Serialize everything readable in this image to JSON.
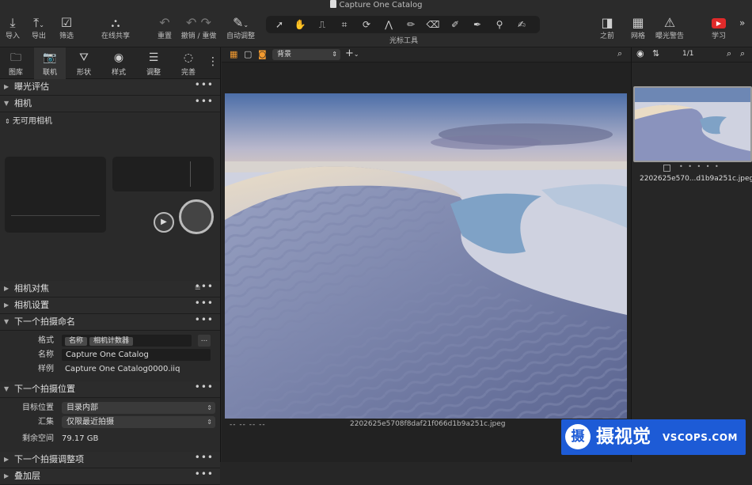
{
  "window": {
    "title": "Capture One Catalog"
  },
  "toolbar": {
    "import": "导入",
    "export": "导出",
    "filter": "筛选",
    "live_share": "在线共享",
    "reset": "重置",
    "undo_redo": "撤销 / 重做",
    "auto_adjust": "自动调整",
    "cursor_tools": "光标工具",
    "before": "之前",
    "grid": "网格",
    "exposure_warning": "曝光警告",
    "learn": "学习"
  },
  "tool_tabs": [
    {
      "label": "图库"
    },
    {
      "label": "联机"
    },
    {
      "label": "形状"
    },
    {
      "label": "样式"
    },
    {
      "label": "调整"
    },
    {
      "label": "完善"
    }
  ],
  "left": {
    "exposure_eval": "曝光评估",
    "camera": "相机",
    "no_camera": "无可用相机",
    "camera_focus": "相机对焦",
    "camera_settings": "相机设置",
    "next_capture_naming": "下一个拍摄命名",
    "format_label": "格式",
    "format_tokens": [
      "名称",
      "相机计数器"
    ],
    "format_more": "...",
    "name_label": "名称",
    "name_value": "Capture One Catalog",
    "sample_label": "样例",
    "sample_value": "Capture One Catalog0000.iiq",
    "next_capture_location": "下一个拍摄位置",
    "dest_label": "目标位置",
    "dest_value": "目录内部",
    "collection_label": "汇集",
    "collection_value": "仅限最近拍摄",
    "space_label": "剩余空间",
    "space_value": "79.17 GB",
    "next_capture_adjust": "下一个拍摄调整项",
    "overlay": "叠加层"
  },
  "viewer": {
    "background_select": "背景",
    "footer_dashes": "--   --   --   --",
    "filename": "2202625e5708f8daf21f066d1b9a251c.jpeg"
  },
  "browser": {
    "count": "1/1",
    "thumb_name": "2202625e570...d1b9a251c.jpeg",
    "rating_dots": "• • • • •"
  },
  "watermark": {
    "brand": "摄视觉",
    "url": "VSCOPS.COM",
    "logo_char": "摄"
  },
  "colors": {
    "accent": "#f39a2f",
    "watermark_bg": "#1d5bd6"
  }
}
